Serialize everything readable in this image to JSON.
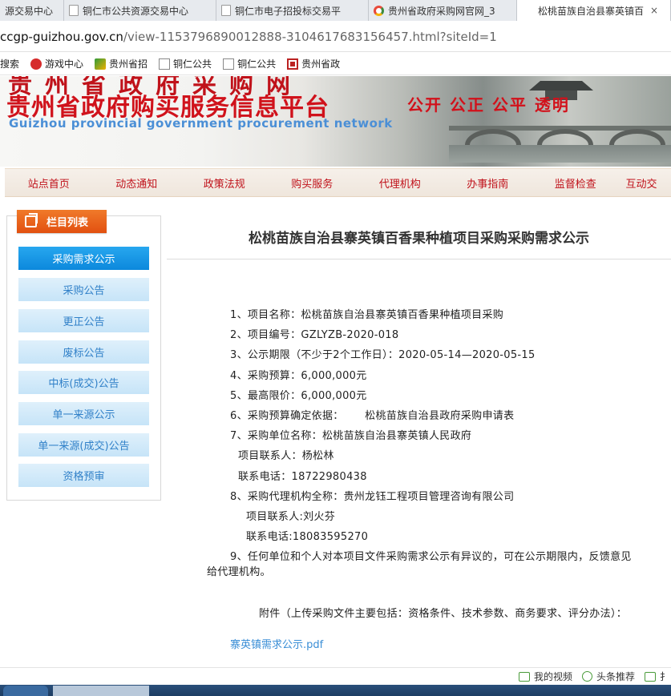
{
  "browser": {
    "tabs": [
      {
        "label": "源交易中心",
        "icon": "page-icon"
      },
      {
        "label": "铜仁市公共资源交易中心",
        "icon": "page-icon"
      },
      {
        "label": "铜仁市电子招投标交易平",
        "icon": "page-icon"
      },
      {
        "label": "贵州省政府采购网官网_3",
        "icon": "globe-icon"
      },
      {
        "label": "松桃苗族自治县寨英镇百",
        "icon": "none",
        "close": "×"
      }
    ],
    "url_host": "ccgp-guizhou.gov.cn",
    "url_path": "/view-1153796890012888-3104617683156457.html?siteId=1",
    "bookmarks": [
      {
        "label": "搜索",
        "icon": "none"
      },
      {
        "label": "游戏中心",
        "icon": "game-icon"
      },
      {
        "label": "贵州省招",
        "icon": "leaf-icon"
      },
      {
        "label": "铜仁公共",
        "icon": "page-icon"
      },
      {
        "label": "铜仁公共",
        "icon": "page-icon"
      },
      {
        "label": "贵州省政",
        "icon": "red-square-icon"
      }
    ]
  },
  "banner": {
    "top_text": "贵州省政府采购网",
    "title": "贵州省政府购买服务信息平台",
    "subtitle": "Guizhou provincial government procurement network",
    "slogan": "公开 公正 公平 透明",
    "colors": {
      "title": "#d0121b",
      "subtitle": "#4b8fd6"
    }
  },
  "nav": {
    "items": [
      "站点首页",
      "动态通知",
      "政策法规",
      "购买服务",
      "代理机构",
      "办事指南",
      "监督检查",
      "互动交"
    ]
  },
  "sidebar": {
    "heading": "栏目列表",
    "items": [
      "采购需求公示",
      "采购公告",
      "更正公告",
      "废标公告",
      "中标(成交)公告",
      "单一来源公示",
      "单一来源(成交)公告",
      "资格预审"
    ],
    "active_index": 0
  },
  "article": {
    "title": "松桃苗族自治县寨英镇百香果种植项目采购采购需求公示",
    "lines": [
      "1、项目名称：松桃苗族自治县寨英镇百香果种植项目采购",
      "2、项目编号：GZLYZB-2020-018",
      "3、公示期限（不少于2个工作日）：2020-05-14—2020-05-15",
      "4、采购预算：6,000,000元",
      "5、最高限价：6,000,000元",
      "6、采购预算确定依据：      松桃苗族自治县政府采购申请表",
      "7、采购单位名称：松桃苗族自治县寨英镇人民政府",
      "项目联系人：杨松林",
      "联系电话：18722980438",
      "8、采购代理机构全称：贵州龙钰工程项目管理咨询有限公司",
      "项目联系人:刘火芬",
      "联系电话:18083595270",
      "9、任何单位和个人对本项目文件采购需求公示有异议的，可在公示期限内，反馈意见",
      "给代理机构。",
      "附件（上传采购文件主要包括：资格条件、技术参数、商务要求、评分办法）："
    ],
    "attachment": "寨英镇需求公示.pdf"
  },
  "statusbar": {
    "items": [
      "我的视频",
      "头条推荐",
      "扌"
    ]
  }
}
